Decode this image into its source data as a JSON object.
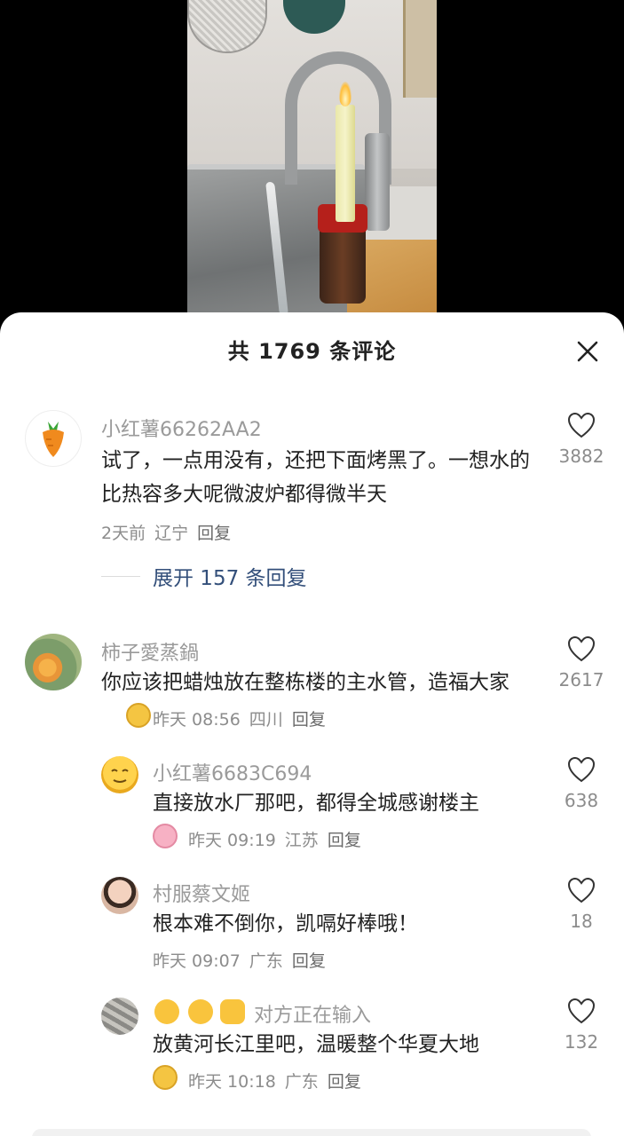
{
  "header": {
    "title": "共 1769 条评论"
  },
  "comments": [
    {
      "username": "小红薯66262AA2",
      "text": "试了，一点用没有，还把下面烤黑了。一想水的比热容多大呢微波炉都得微半天",
      "time": "2天前",
      "location": "辽宁",
      "reply_label": "回复",
      "likes": "3882",
      "expand_label": "展开 157 条回复"
    },
    {
      "username": "柿子愛蒸鍋",
      "text": "你应该把蜡烛放在整栋楼的主水管，造福大家",
      "time": "昨天 08:56",
      "location": "四川",
      "reply_label": "回复",
      "likes": "2617"
    },
    {
      "username": "小红薯6683C694",
      "text": "直接放水厂那吧，都得全城感谢楼主",
      "time": "昨天 09:19",
      "location": "江苏",
      "reply_label": "回复",
      "likes": "638"
    },
    {
      "username": "村服蔡文姬",
      "text": "根本难不倒你，凯嗝好棒哦！",
      "time": "昨天 09:07",
      "location": "广东",
      "reply_label": "回复",
      "likes": "18"
    },
    {
      "username": "对方正在输入",
      "text": "放黄河长江里吧，温暖整个华夏大地",
      "time": "昨天 10:18",
      "location": "广东",
      "reply_label": "回复",
      "likes": "132"
    }
  ],
  "colors": {
    "sheet_bg": "#ffffff",
    "link": "#334f7a",
    "muted": "#9a9a9a",
    "text": "#222222"
  },
  "icons": [
    "close-icon",
    "heart-icon",
    "carrot-icon"
  ]
}
